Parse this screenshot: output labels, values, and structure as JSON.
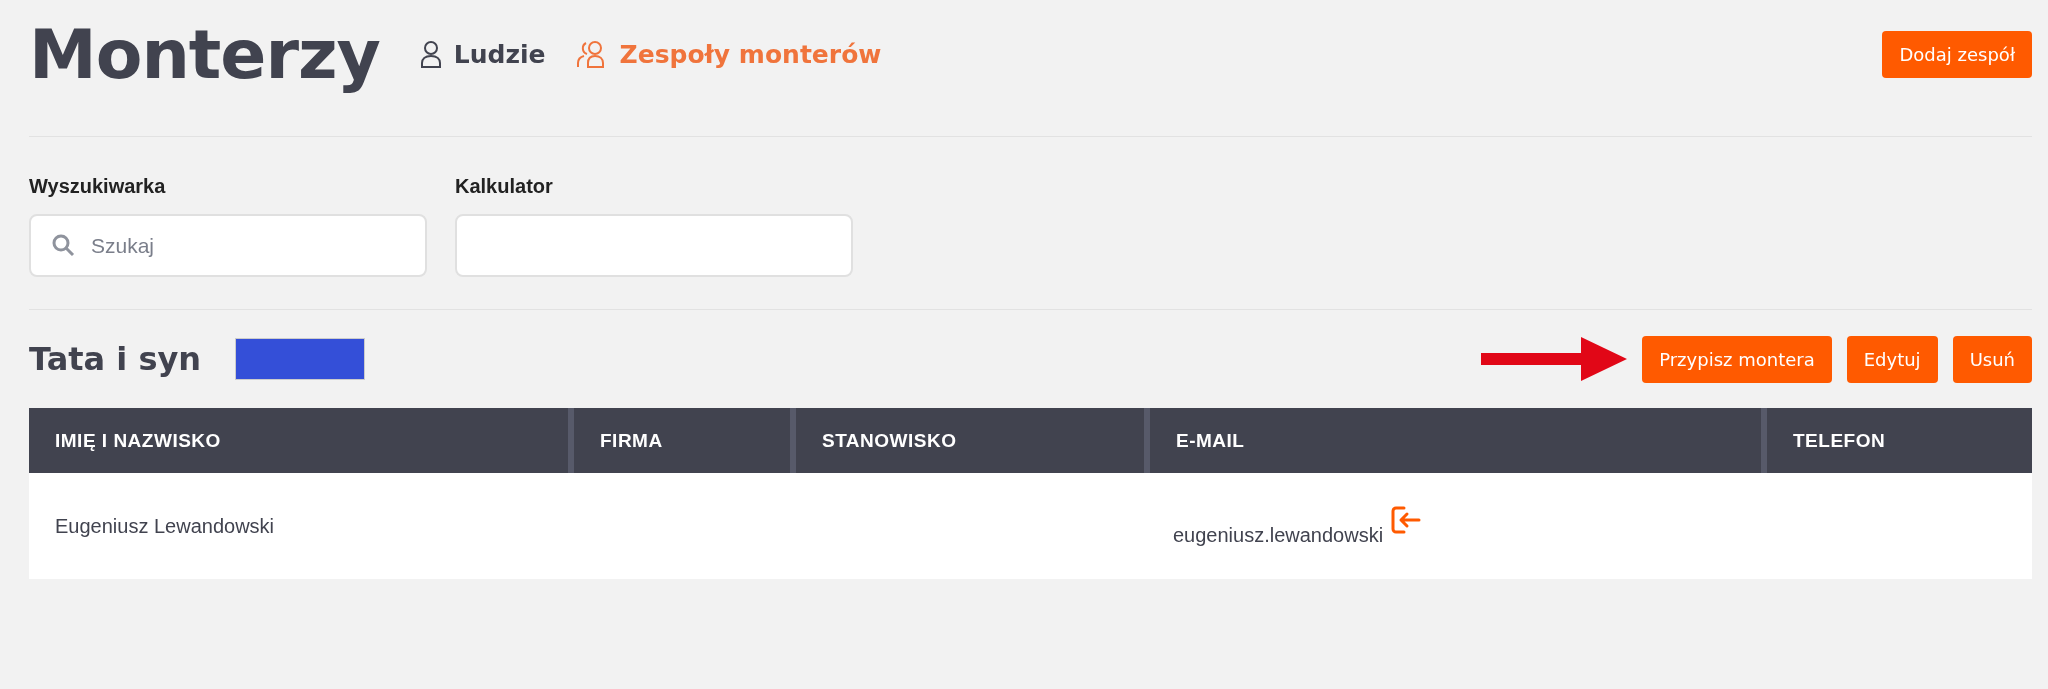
{
  "page": {
    "title": "Monterzy"
  },
  "nav": [
    {
      "label": "Ludzie",
      "kind": "person",
      "selected": false
    },
    {
      "label": "Zespoły monterów",
      "kind": "group",
      "selected": true
    }
  ],
  "add_button": "Dodaj zespół",
  "filters": [
    {
      "label": "Wyszukiwarka",
      "placeholder": "Szukaj",
      "kind": "search"
    },
    {
      "label": "Kalkulator",
      "kind": "plain"
    }
  ],
  "team": {
    "name": "Tata i syn",
    "color": "#344fd8",
    "actions": [
      "Przypisz montera",
      "Edytuj",
      "Usuń"
    ]
  },
  "table": {
    "columns": [
      "IMIĘ I NAZWISKO",
      "FIRMA",
      "STANOWISKO",
      "E-MAIL",
      "TELEFON"
    ],
    "rows": [
      {
        "cells": [
          "Eugeniusz Lewandowski",
          "",
          "",
          "eugeniusz.lewandowski",
          ""
        ],
        "login_icon": true
      }
    ]
  }
}
